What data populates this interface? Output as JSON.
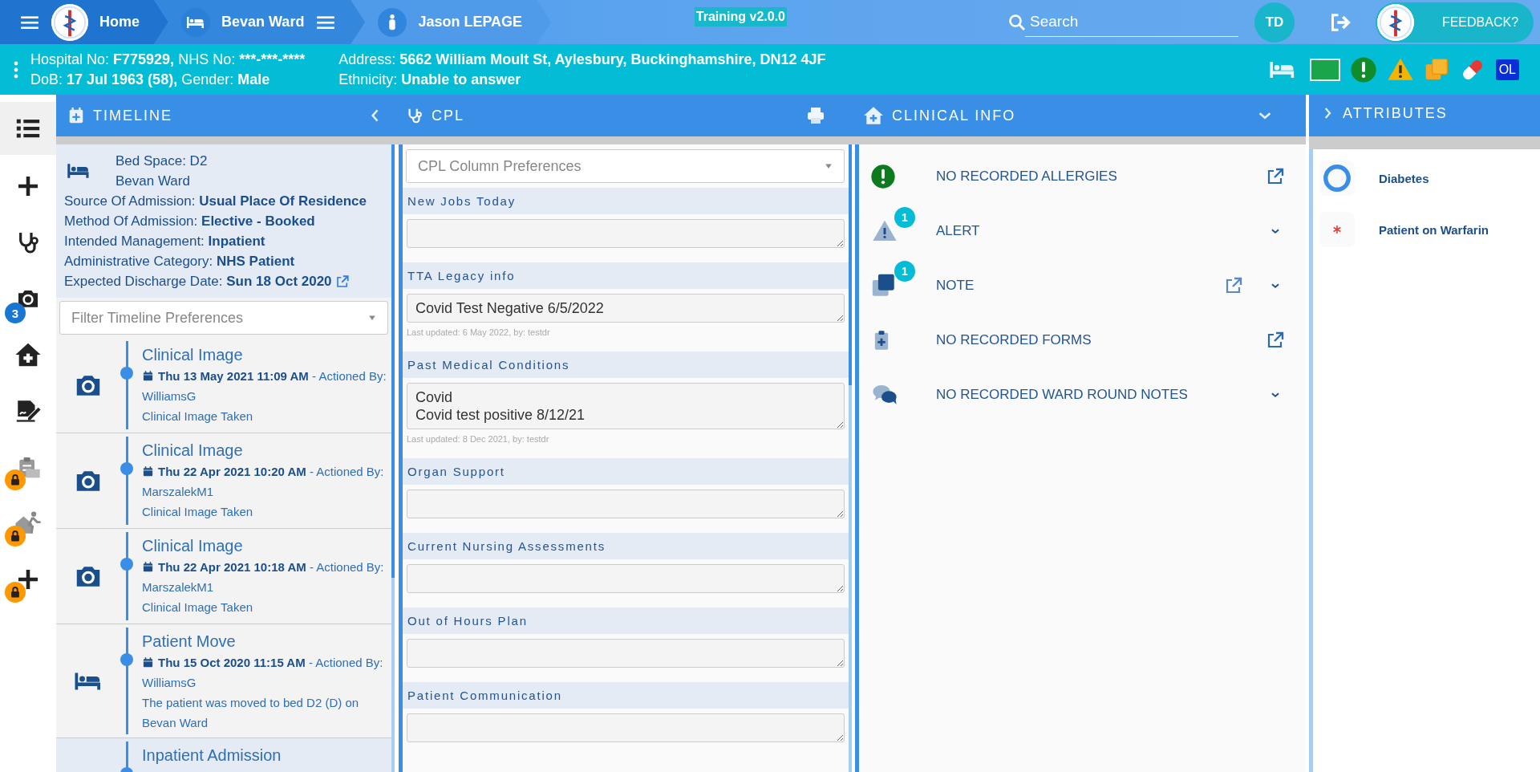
{
  "nav": {
    "crumbs": [
      {
        "kind": "home",
        "label": "Home"
      },
      {
        "kind": "ward",
        "label": "Bevan Ward"
      },
      {
        "kind": "patient",
        "label": "Jason LEPAGE"
      }
    ],
    "environment": "Training v2.0.0",
    "search": {
      "placeholder": "Search"
    },
    "user_initials": "TD",
    "feedback": "FEEDBACK?"
  },
  "patient_banner": {
    "columns": [
      [
        [
          {
            "label": "Hospital No:",
            "value": "F775929,"
          },
          {
            "label": "NHS No:",
            "value": "***-***-****"
          }
        ],
        [
          {
            "label": "DoB:",
            "value": "17 Jul 1963 (58),"
          },
          {
            "label": "Gender:",
            "value": "Male"
          }
        ]
      ],
      [
        [
          {
            "label": "Address:",
            "value": "5662 William Moult St, Aylesbury, Buckinghamshire, DN12 4JF"
          }
        ],
        [
          {
            "label": "Ethnicity:",
            "value": "Unable to answer"
          }
        ]
      ]
    ],
    "flags": [
      {
        "kind": "bed"
      },
      {
        "kind": "green_box"
      },
      {
        "kind": "allergy"
      },
      {
        "kind": "warning"
      },
      {
        "kind": "notes"
      },
      {
        "kind": "medication"
      },
      {
        "kind": "initials",
        "label": "OL"
      }
    ]
  },
  "sidebar": {
    "items": [
      {
        "kind": "timeline",
        "selected": true,
        "locked": false
      },
      {
        "kind": "add",
        "selected": false,
        "locked": false
      },
      {
        "kind": "cpl",
        "selected": false,
        "locked": false
      },
      {
        "kind": "images",
        "selected": false,
        "locked": false,
        "badge": "3"
      },
      {
        "kind": "clinical_info",
        "selected": false,
        "locked": false
      },
      {
        "kind": "signature",
        "selected": false,
        "locked": false
      },
      {
        "kind": "clipboard",
        "selected": false,
        "locked": true
      },
      {
        "kind": "discharge",
        "selected": false,
        "locked": true
      },
      {
        "kind": "add",
        "selected": false,
        "locked": true
      }
    ]
  },
  "timeline": {
    "title": "TIMELINE",
    "admission": {
      "bed_lines": [
        "Bed Space: D2",
        "Bevan Ward"
      ],
      "details": [
        {
          "kind": "text",
          "label": "Source Of Admission:",
          "value": "Usual Place Of Residence"
        },
        {
          "kind": "text",
          "label": "Method Of Admission:",
          "value": "Elective - Booked"
        },
        {
          "kind": "text",
          "label": "Intended Management:",
          "value": "Inpatient"
        },
        {
          "kind": "text",
          "label": "Administrative Category:",
          "value": "NHS Patient"
        },
        {
          "kind": "linked_date",
          "label": "Expected Discharge Date:",
          "value": "Sun 18 Oct 2020"
        }
      ]
    },
    "filter": {
      "placeholder": "Filter Timeline Preferences"
    },
    "events": [
      {
        "kind": "image",
        "title": "Clinical Image",
        "date": "Thu 13 May 2021 11:09 AM",
        "actioned_label": "- Actioned By:",
        "user": "WilliamsG",
        "description": "Clinical Image Taken"
      },
      {
        "kind": "image",
        "title": "Clinical Image",
        "date": "Thu 22 Apr 2021 10:20 AM",
        "actioned_label": "- Actioned By:",
        "user": "MarszalekM1",
        "description": "Clinical Image Taken"
      },
      {
        "kind": "image",
        "title": "Clinical Image",
        "date": "Thu 22 Apr 2021 10:18 AM",
        "actioned_label": "- Actioned By:",
        "user": "MarszalekM1",
        "description": "Clinical Image Taken"
      },
      {
        "kind": "move",
        "title": "Patient Move",
        "date": "Thu 15 Oct 2020 11:15 AM",
        "actioned_label": "- Actioned By:",
        "user": "WilliamsG",
        "description": "The patient was moved to bed D2 (D) on Bevan Ward"
      },
      {
        "kind": "admission",
        "title": "Inpatient Admission"
      }
    ]
  },
  "cpl": {
    "title": "CPL",
    "preferences": {
      "placeholder": "CPL Column Preferences"
    },
    "sections": [
      {
        "label": "New Jobs Today"
      },
      {
        "label": "TTA Legacy info",
        "value": "Covid Test Negative 6/5/2022",
        "updated": "Last updated: 6 May 2022, by: testdr"
      },
      {
        "label": "Past Medical Conditions",
        "value": "Covid\nCovid test positive 8/12/21",
        "updated": "Last updated: 8 Dec 2021, by: testdr"
      },
      {
        "label": "Organ Support"
      },
      {
        "label": "Current Nursing Assessments"
      },
      {
        "label": "Out of Hours Plan"
      },
      {
        "label": "Patient Communication"
      }
    ]
  },
  "clinical_info": {
    "title": "CLINICAL INFO",
    "items": [
      {
        "kind": "allergies",
        "label": "NO RECORDED ALLERGIES",
        "open_link": true,
        "expandable": false
      },
      {
        "kind": "alert",
        "label": "ALERT",
        "count": "1",
        "open_link": false,
        "expandable": true
      },
      {
        "kind": "note",
        "label": "NOTE",
        "count": "1",
        "open_link": true,
        "expandable": true
      },
      {
        "kind": "forms",
        "label": "NO RECORDED FORMS",
        "open_link": true,
        "expandable": false
      },
      {
        "kind": "ward_round",
        "label": "NO RECORDED WARD ROUND NOTES",
        "open_link": false,
        "expandable": true
      }
    ]
  },
  "attributes": {
    "title": "ATTRIBUTES",
    "items": [
      {
        "kind": "ring",
        "label": "Diabetes"
      },
      {
        "kind": "asterisk",
        "label": "Patient on Warfarin"
      }
    ]
  }
}
